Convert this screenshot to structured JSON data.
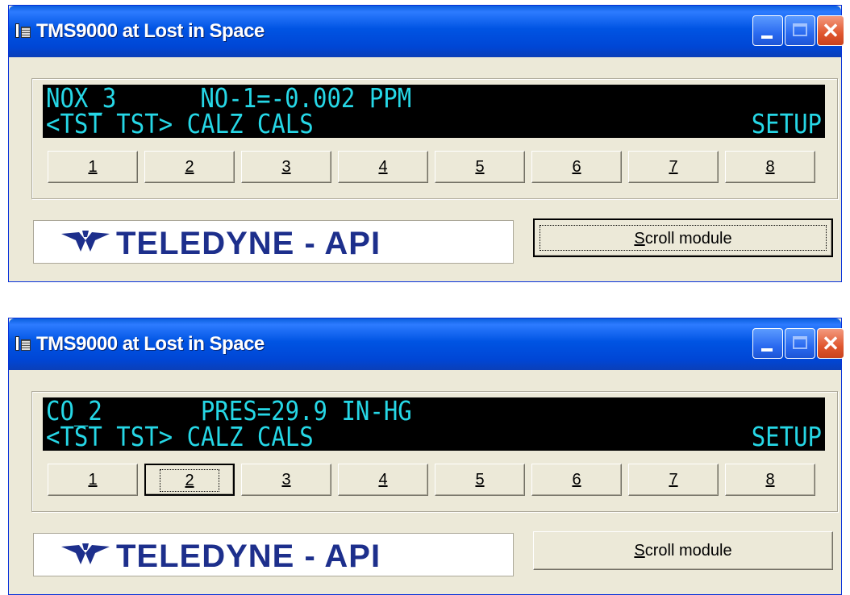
{
  "windows": [
    {
      "title": "TMS9000 at Lost in Space",
      "display": {
        "line1_left": "NOX_3",
        "line1_right": "NO-1=-0.002 PPM",
        "line2_left": "<TST TST> CALZ CALS",
        "line2_right": "SETUP"
      },
      "keys": [
        "1",
        "2",
        "3",
        "4",
        "5",
        "6",
        "7",
        "8"
      ],
      "logo_text": "TELEDYNE - API",
      "scroll_button": {
        "mnemonic": "S",
        "rest": "croll module"
      },
      "focused": "scroll_module"
    },
    {
      "title": "TMS9000 at Lost in Space",
      "display": {
        "line1_left": "CO_2",
        "line1_right": "PRES=29.9 IN-HG",
        "line2_left": "<TST TST> CALZ CALS",
        "line2_right": "SETUP"
      },
      "keys": [
        "1",
        "2",
        "3",
        "4",
        "5",
        "6",
        "7",
        "8"
      ],
      "logo_text": "TELEDYNE - API",
      "scroll_button": {
        "mnemonic": "S",
        "rest": "croll module"
      },
      "focused": "key_2"
    }
  ],
  "colors": {
    "lcd_text": "#26d7e6",
    "lcd_background": "#000000",
    "logo_text": "#1d2f8c",
    "titlebar": "#0054e3"
  },
  "icons": {
    "app": "app-window-icon",
    "minimize": "minimize-icon",
    "maximize": "maximize-icon",
    "close": "close-icon",
    "logo": "teledyne-logo-icon"
  }
}
